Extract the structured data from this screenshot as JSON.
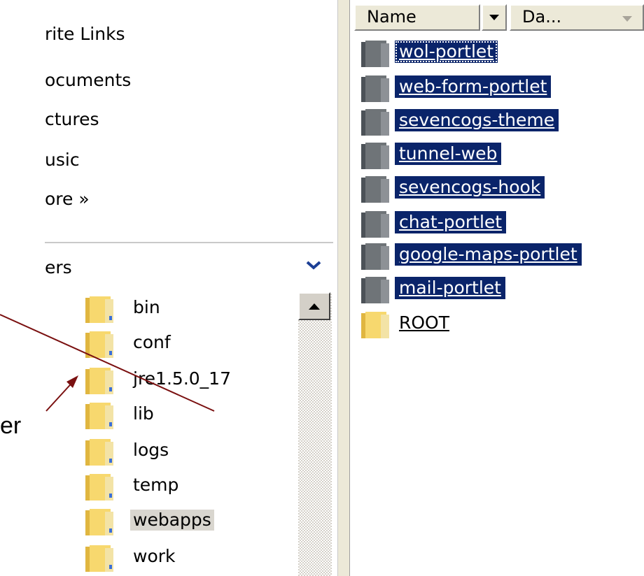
{
  "favorites": {
    "items": [
      {
        "label": "rite Links"
      },
      {
        "label": "ocuments"
      },
      {
        "label": "ctures"
      },
      {
        "label": "usic"
      },
      {
        "label": "ore    »"
      }
    ]
  },
  "folders": {
    "header": "ers",
    "tree": [
      {
        "label": "bin"
      },
      {
        "label": "conf"
      },
      {
        "label": "jre1.5.0_17"
      },
      {
        "label": "lib"
      },
      {
        "label": "logs"
      },
      {
        "label": "temp"
      },
      {
        "label": "webapps",
        "selected": true
      },
      {
        "label": "work"
      }
    ]
  },
  "file_list": {
    "columns": [
      {
        "label": "Name"
      },
      {
        "label": "Da..."
      }
    ],
    "rows": [
      {
        "name": "wol-portlet",
        "selected": true,
        "focused": true
      },
      {
        "name": "web-form-portlet",
        "selected": true
      },
      {
        "name": "sevencogs-theme",
        "selected": true
      },
      {
        "name": "tunnel-web",
        "selected": true
      },
      {
        "name": "sevencogs-hook",
        "selected": true
      },
      {
        "name": "chat-portlet",
        "selected": true
      },
      {
        "name": "google-maps-portlet",
        "selected": true
      },
      {
        "name": "mail-portlet",
        "selected": true
      },
      {
        "name": "ROOT",
        "selected": false
      }
    ]
  },
  "annotation": {
    "text": "er"
  },
  "colors": {
    "selection": "#0a246a",
    "annotation": "#7a1010",
    "folder_yellow": "#f5d36b",
    "folder_gray": "#6f7478"
  }
}
